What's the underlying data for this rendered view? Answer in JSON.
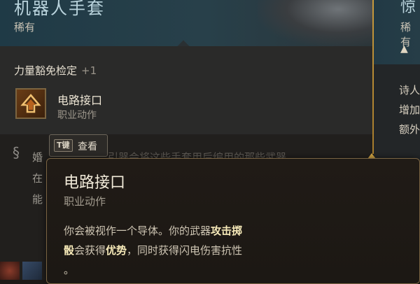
{
  "item": {
    "title": "机器人手套",
    "rarity": "稀有",
    "check_label": "力量豁免检定",
    "check_bonus": "+1",
    "action_name": "电路接口",
    "action_type": "职业动作",
    "desc_line1": "婚",
    "desc_line1_faded": "引器会将这些手套用后编用的那些武器",
    "desc_line2": "在",
    "desc_line3": "能",
    "view_key": "T键",
    "view_label": "查看"
  },
  "right_item": {
    "title": "惊",
    "rarity": "稀有",
    "line1": "诗人",
    "line2": "增加",
    "line3": "额外"
  },
  "tooltip": {
    "title": "电路接口",
    "subtitle": "职业动作",
    "line1_a": "你会被视作一个导体。你的武器",
    "line1_hl": "攻击掷",
    "line2_hl1": "骰",
    "line2_a": "会获得",
    "line2_hl2": "优势",
    "line2_b": "，同时获得闪电伤害抗性",
    "line3": "。"
  },
  "colors": {
    "accent_gold": "#c89a3c",
    "title_blue": "#b9d3dc",
    "tooltip_border": "#7a6443"
  },
  "icons": {
    "action": "arrow-up-lightning-icon",
    "desc": "hook-icon",
    "warning": "warning-icon"
  }
}
